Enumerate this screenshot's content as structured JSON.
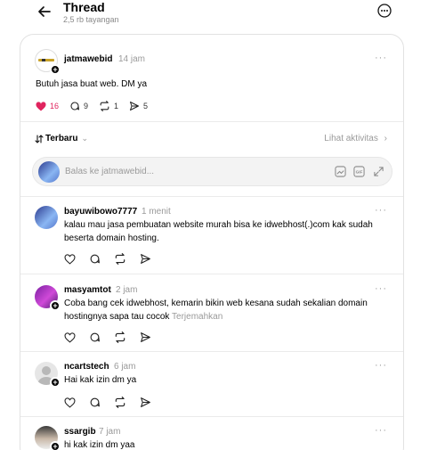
{
  "header": {
    "title": "Thread",
    "views": "2,5 rb tayangan"
  },
  "post": {
    "username": "jatmawebid",
    "time": "14 jam",
    "text": "Butuh jasa buat web. DM ya",
    "likes": "16",
    "replies": "9",
    "reposts": "1",
    "shares": "5",
    "more": "···"
  },
  "sort": {
    "label": "Terbaru",
    "activity": "Lihat aktivitas"
  },
  "reply_box": {
    "placeholder": "Balas ke jatmawebid..."
  },
  "comments": [
    {
      "username": "bayuwibowo7777",
      "time": "1 menit",
      "line1": "kalau mau jasa pembuatan website murah bisa ke idwebhost(.)com kak sudah",
      "line2": "beserta domain hosting."
    },
    {
      "username": "masyamtot",
      "time": "2 jam",
      "line1": "Coba bang cek idwebhost, kemarin bikin web kesana sudah sekalian domain",
      "line2": "hostingnya sapa tau cocok",
      "translate": "Terjemahkan"
    },
    {
      "username": "ncartstech",
      "time": "6 jam",
      "line1": "Hai kak izin dm ya"
    },
    {
      "username": "ssargib",
      "time": "7 jam",
      "line1": "hi kak izin dm yaa"
    }
  ],
  "colors": {
    "like": "#e0245e",
    "muted": "#9a9a9a",
    "border": "#e2e2e2"
  }
}
